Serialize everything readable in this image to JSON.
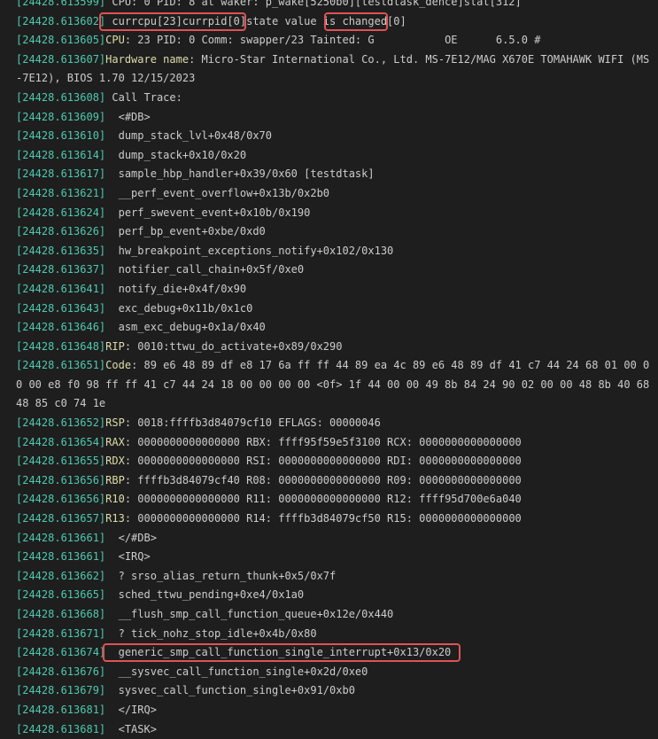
{
  "terminal": {
    "lines": [
      {
        "ts": "[24428.613599]",
        "key": "",
        "text": " CPU: 0 PID: 8 at waker: p_wake[5250b0][testdtask_dence]stat[312]"
      },
      {
        "ts": "[24428.613602]",
        "key": "",
        "text": " currcpu[23]currpid[0]state value is changed[0]"
      },
      {
        "ts": "[24428.613605]",
        "key": "CPU",
        "text": ": 23 PID: 0 Comm: swapper/23 Tainted: G           OE      6.5.0 #"
      },
      {
        "ts": "[24428.613607]",
        "key": "Hardware name",
        "text": ": Micro-Star International Co., Ltd. MS-7E12/MAG X670E TOMAHAWK WIFI (MS"
      },
      {
        "ts": "",
        "key": "",
        "text": "-7E12), BIOS 1.70 12/15/2023"
      },
      {
        "ts": "[24428.613608]",
        "key": "",
        "text": " Call Trace:"
      },
      {
        "ts": "[24428.613609]",
        "key": "",
        "text": "  <#DB>"
      },
      {
        "ts": "[24428.613610]",
        "key": "",
        "text": "  dump_stack_lvl+0x48/0x70"
      },
      {
        "ts": "[24428.613614]",
        "key": "",
        "text": "  dump_stack+0x10/0x20"
      },
      {
        "ts": "[24428.613617]",
        "key": "",
        "text": "  sample_hbp_handler+0x39/0x60 [testdtask]"
      },
      {
        "ts": "[24428.613621]",
        "key": "",
        "text": "  __perf_event_overflow+0x13b/0x2b0"
      },
      {
        "ts": "[24428.613624]",
        "key": "",
        "text": "  perf_swevent_event+0x10b/0x190"
      },
      {
        "ts": "[24428.613626]",
        "key": "",
        "text": "  perf_bp_event+0xbe/0xd0"
      },
      {
        "ts": "[24428.613635]",
        "key": "",
        "text": "  hw_breakpoint_exceptions_notify+0x102/0x130"
      },
      {
        "ts": "[24428.613637]",
        "key": "",
        "text": "  notifier_call_chain+0x5f/0xe0"
      },
      {
        "ts": "[24428.613641]",
        "key": "",
        "text": "  notify_die+0x4f/0x90"
      },
      {
        "ts": "[24428.613643]",
        "key": "",
        "text": "  exc_debug+0x11b/0x1c0"
      },
      {
        "ts": "[24428.613646]",
        "key": "",
        "text": "  asm_exc_debug+0x1a/0x40"
      },
      {
        "ts": "[24428.613648]",
        "key": "RIP",
        "text": ": 0010:ttwu_do_activate+0x89/0x290"
      },
      {
        "ts": "[24428.613651]",
        "key": "Code",
        "text": ": 89 e6 48 89 df e8 17 6a ff ff 44 89 ea 4c 89 e6 48 89 df 41 c7 44 24 68 01 00 0"
      },
      {
        "ts": "",
        "key": "",
        "text": "0 00 e8 f0 98 ff ff 41 c7 44 24 18 00 00 00 00 <0f> 1f 44 00 00 49 8b 84 24 90 02 00 00 48 8b 40 68"
      },
      {
        "ts": "",
        "key": "",
        "text": "48 85 c0 74 1e"
      },
      {
        "ts": "[24428.613652]",
        "key": "RSP",
        "text": ": 0018:ffffb3d84079cf10 EFLAGS: 00000046"
      },
      {
        "ts": "[24428.613654]",
        "key": "RAX",
        "text": ": 0000000000000000 RBX: ffff95f59e5f3100 RCX: 0000000000000000"
      },
      {
        "ts": "[24428.613655]",
        "key": "RDX",
        "text": ": 0000000000000000 RSI: 0000000000000000 RDI: 0000000000000000"
      },
      {
        "ts": "[24428.613656]",
        "key": "RBP",
        "text": ": ffffb3d84079cf40 R08: 0000000000000000 R09: 0000000000000000"
      },
      {
        "ts": "[24428.613656]",
        "key": "R10",
        "text": ": 0000000000000000 R11: 0000000000000000 R12: ffff95d700e6a040"
      },
      {
        "ts": "[24428.613657]",
        "key": "R13",
        "text": ": 0000000000000000 R14: ffffb3d84079cf50 R15: 0000000000000000"
      },
      {
        "ts": "[24428.613661]",
        "key": "",
        "text": "  </#DB>"
      },
      {
        "ts": "[24428.613661]",
        "key": "",
        "text": "  <IRQ>"
      },
      {
        "ts": "[24428.613662]",
        "key": "",
        "text": "  ? srso_alias_return_thunk+0x5/0x7f"
      },
      {
        "ts": "[24428.613665]",
        "key": "",
        "text": "  sched_ttwu_pending+0xe4/0x1a0"
      },
      {
        "ts": "[24428.613668]",
        "key": "",
        "text": "  __flush_smp_call_function_queue+0x12e/0x440"
      },
      {
        "ts": "[24428.613671]",
        "key": "",
        "text": "  ? tick_nohz_stop_idle+0x4b/0x80"
      },
      {
        "ts": "[24428.613674]",
        "key": "",
        "text": "  generic_smp_call_function_single_interrupt+0x13/0x20"
      },
      {
        "ts": "[24428.613676]",
        "key": "",
        "text": "  __sysvec_call_function_single+0x2d/0xe0"
      },
      {
        "ts": "[24428.613679]",
        "key": "",
        "text": "  sysvec_call_function_single+0x91/0xb0"
      },
      {
        "ts": "[24428.613681]",
        "key": "",
        "text": "  </IRQ>"
      },
      {
        "ts": "[24428.613681]",
        "key": "",
        "text": "  <TASK>"
      }
    ]
  }
}
